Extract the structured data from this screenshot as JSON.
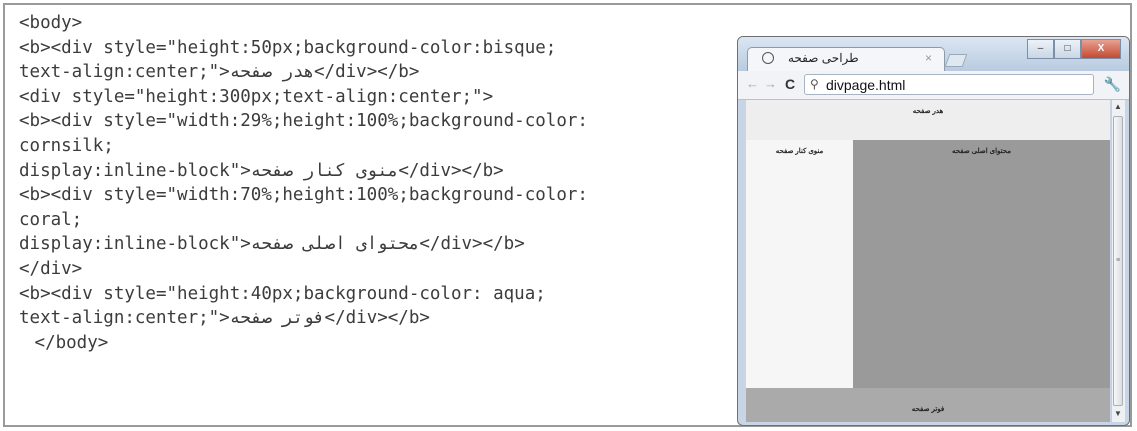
{
  "code_lines": [
    "<body>",
    "<b><div style=\"height:50px;background-color:bisque;",
    "text-align:center;\">هدر صفحه</div></b>",
    "<div style=\"height:300px;text-align:center;\">",
    "<b><div style=\"width:29%;height:100%;background-color:",
    "cornsilk;",
    "display:inline-block\">منوی کنار صفحه</div></b>",
    "<b><div style=\"width:70%;height:100%;background-color:",
    "coral;",
    "display:inline-block\">محتوای اصلی صفحه</div></b>",
    "</div>",
    "<b><div style=\"height:40px;background-color: aqua;",
    "text-align:center;\">فوتر صفحه</div></b>",
    " </body>"
  ],
  "browser": {
    "tab_title": "طراحی صفحه",
    "tab_close": "×",
    "window_buttons": {
      "minimize": "–",
      "maximize": "□",
      "close": "X"
    },
    "nav": {
      "back": "←",
      "forward": "→",
      "reload": "C"
    },
    "address_icon": "search-icon",
    "address": "divpage.html",
    "menu_icon": "wrench-icon"
  },
  "page": {
    "header": "هدر صفحه",
    "sidebar": "منوی کنار صفحه",
    "main": "محتوای اصلی صفحه",
    "footer": "فوتر صفحه"
  },
  "colors": {
    "header": "#eeeeee",
    "sidebar": "#f6f6f6",
    "main": "#9a9a9a",
    "footer": "#aaaaaa"
  }
}
